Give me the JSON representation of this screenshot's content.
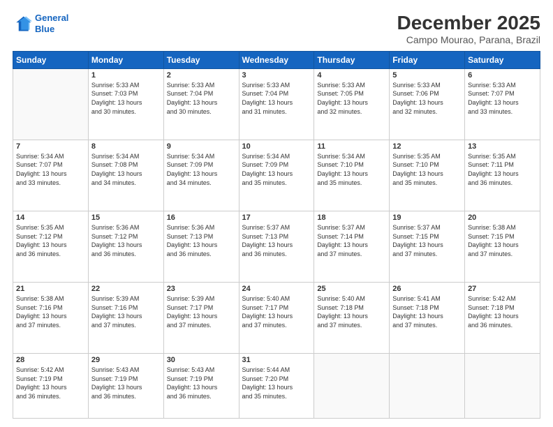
{
  "logo": {
    "line1": "General",
    "line2": "Blue"
  },
  "header": {
    "month": "December 2025",
    "location": "Campo Mourao, Parana, Brazil"
  },
  "weekdays": [
    "Sunday",
    "Monday",
    "Tuesday",
    "Wednesday",
    "Thursday",
    "Friday",
    "Saturday"
  ],
  "weeks": [
    [
      {
        "day": "",
        "info": ""
      },
      {
        "day": "1",
        "info": "Sunrise: 5:33 AM\nSunset: 7:03 PM\nDaylight: 13 hours\nand 30 minutes."
      },
      {
        "day": "2",
        "info": "Sunrise: 5:33 AM\nSunset: 7:04 PM\nDaylight: 13 hours\nand 30 minutes."
      },
      {
        "day": "3",
        "info": "Sunrise: 5:33 AM\nSunset: 7:04 PM\nDaylight: 13 hours\nand 31 minutes."
      },
      {
        "day": "4",
        "info": "Sunrise: 5:33 AM\nSunset: 7:05 PM\nDaylight: 13 hours\nand 32 minutes."
      },
      {
        "day": "5",
        "info": "Sunrise: 5:33 AM\nSunset: 7:06 PM\nDaylight: 13 hours\nand 32 minutes."
      },
      {
        "day": "6",
        "info": "Sunrise: 5:33 AM\nSunset: 7:07 PM\nDaylight: 13 hours\nand 33 minutes."
      }
    ],
    [
      {
        "day": "7",
        "info": "Sunrise: 5:34 AM\nSunset: 7:07 PM\nDaylight: 13 hours\nand 33 minutes."
      },
      {
        "day": "8",
        "info": "Sunrise: 5:34 AM\nSunset: 7:08 PM\nDaylight: 13 hours\nand 34 minutes."
      },
      {
        "day": "9",
        "info": "Sunrise: 5:34 AM\nSunset: 7:09 PM\nDaylight: 13 hours\nand 34 minutes."
      },
      {
        "day": "10",
        "info": "Sunrise: 5:34 AM\nSunset: 7:09 PM\nDaylight: 13 hours\nand 35 minutes."
      },
      {
        "day": "11",
        "info": "Sunrise: 5:34 AM\nSunset: 7:10 PM\nDaylight: 13 hours\nand 35 minutes."
      },
      {
        "day": "12",
        "info": "Sunrise: 5:35 AM\nSunset: 7:10 PM\nDaylight: 13 hours\nand 35 minutes."
      },
      {
        "day": "13",
        "info": "Sunrise: 5:35 AM\nSunset: 7:11 PM\nDaylight: 13 hours\nand 36 minutes."
      }
    ],
    [
      {
        "day": "14",
        "info": "Sunrise: 5:35 AM\nSunset: 7:12 PM\nDaylight: 13 hours\nand 36 minutes."
      },
      {
        "day": "15",
        "info": "Sunrise: 5:36 AM\nSunset: 7:12 PM\nDaylight: 13 hours\nand 36 minutes."
      },
      {
        "day": "16",
        "info": "Sunrise: 5:36 AM\nSunset: 7:13 PM\nDaylight: 13 hours\nand 36 minutes."
      },
      {
        "day": "17",
        "info": "Sunrise: 5:37 AM\nSunset: 7:13 PM\nDaylight: 13 hours\nand 36 minutes."
      },
      {
        "day": "18",
        "info": "Sunrise: 5:37 AM\nSunset: 7:14 PM\nDaylight: 13 hours\nand 37 minutes."
      },
      {
        "day": "19",
        "info": "Sunrise: 5:37 AM\nSunset: 7:15 PM\nDaylight: 13 hours\nand 37 minutes."
      },
      {
        "day": "20",
        "info": "Sunrise: 5:38 AM\nSunset: 7:15 PM\nDaylight: 13 hours\nand 37 minutes."
      }
    ],
    [
      {
        "day": "21",
        "info": "Sunrise: 5:38 AM\nSunset: 7:16 PM\nDaylight: 13 hours\nand 37 minutes."
      },
      {
        "day": "22",
        "info": "Sunrise: 5:39 AM\nSunset: 7:16 PM\nDaylight: 13 hours\nand 37 minutes."
      },
      {
        "day": "23",
        "info": "Sunrise: 5:39 AM\nSunset: 7:17 PM\nDaylight: 13 hours\nand 37 minutes."
      },
      {
        "day": "24",
        "info": "Sunrise: 5:40 AM\nSunset: 7:17 PM\nDaylight: 13 hours\nand 37 minutes."
      },
      {
        "day": "25",
        "info": "Sunrise: 5:40 AM\nSunset: 7:18 PM\nDaylight: 13 hours\nand 37 minutes."
      },
      {
        "day": "26",
        "info": "Sunrise: 5:41 AM\nSunset: 7:18 PM\nDaylight: 13 hours\nand 37 minutes."
      },
      {
        "day": "27",
        "info": "Sunrise: 5:42 AM\nSunset: 7:18 PM\nDaylight: 13 hours\nand 36 minutes."
      }
    ],
    [
      {
        "day": "28",
        "info": "Sunrise: 5:42 AM\nSunset: 7:19 PM\nDaylight: 13 hours\nand 36 minutes."
      },
      {
        "day": "29",
        "info": "Sunrise: 5:43 AM\nSunset: 7:19 PM\nDaylight: 13 hours\nand 36 minutes."
      },
      {
        "day": "30",
        "info": "Sunrise: 5:43 AM\nSunset: 7:19 PM\nDaylight: 13 hours\nand 36 minutes."
      },
      {
        "day": "31",
        "info": "Sunrise: 5:44 AM\nSunset: 7:20 PM\nDaylight: 13 hours\nand 35 minutes."
      },
      {
        "day": "",
        "info": ""
      },
      {
        "day": "",
        "info": ""
      },
      {
        "day": "",
        "info": ""
      }
    ]
  ]
}
